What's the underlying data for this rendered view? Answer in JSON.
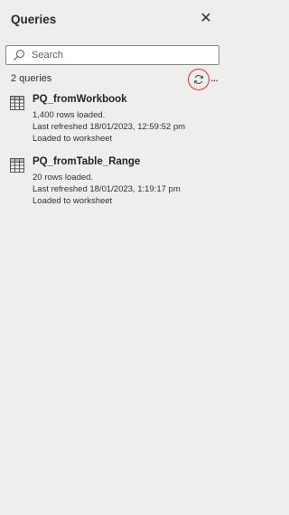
{
  "pane": {
    "title": "Queries",
    "close_icon": "close-icon"
  },
  "search": {
    "placeholder": "Search",
    "value": ""
  },
  "queries_count": "2 queries",
  "toolbar": {
    "refresh_icon": "refresh-icon",
    "more_label": "..."
  },
  "queries": [
    {
      "name": "PQ_fromWorkbook",
      "rows": "1,400 rows loaded.",
      "refreshed": "Last refreshed 18/01/2023, 12:59:52 pm",
      "loaded": "Loaded to worksheet"
    },
    {
      "name": "PQ_fromTable_Range",
      "rows": "20 rows loaded.",
      "refreshed": "Last refreshed 18/01/2023, 1:19:17 pm",
      "loaded": "Loaded to worksheet"
    }
  ],
  "colors": {
    "background": "#efeeec",
    "highlight_circle": "#e0302c"
  }
}
